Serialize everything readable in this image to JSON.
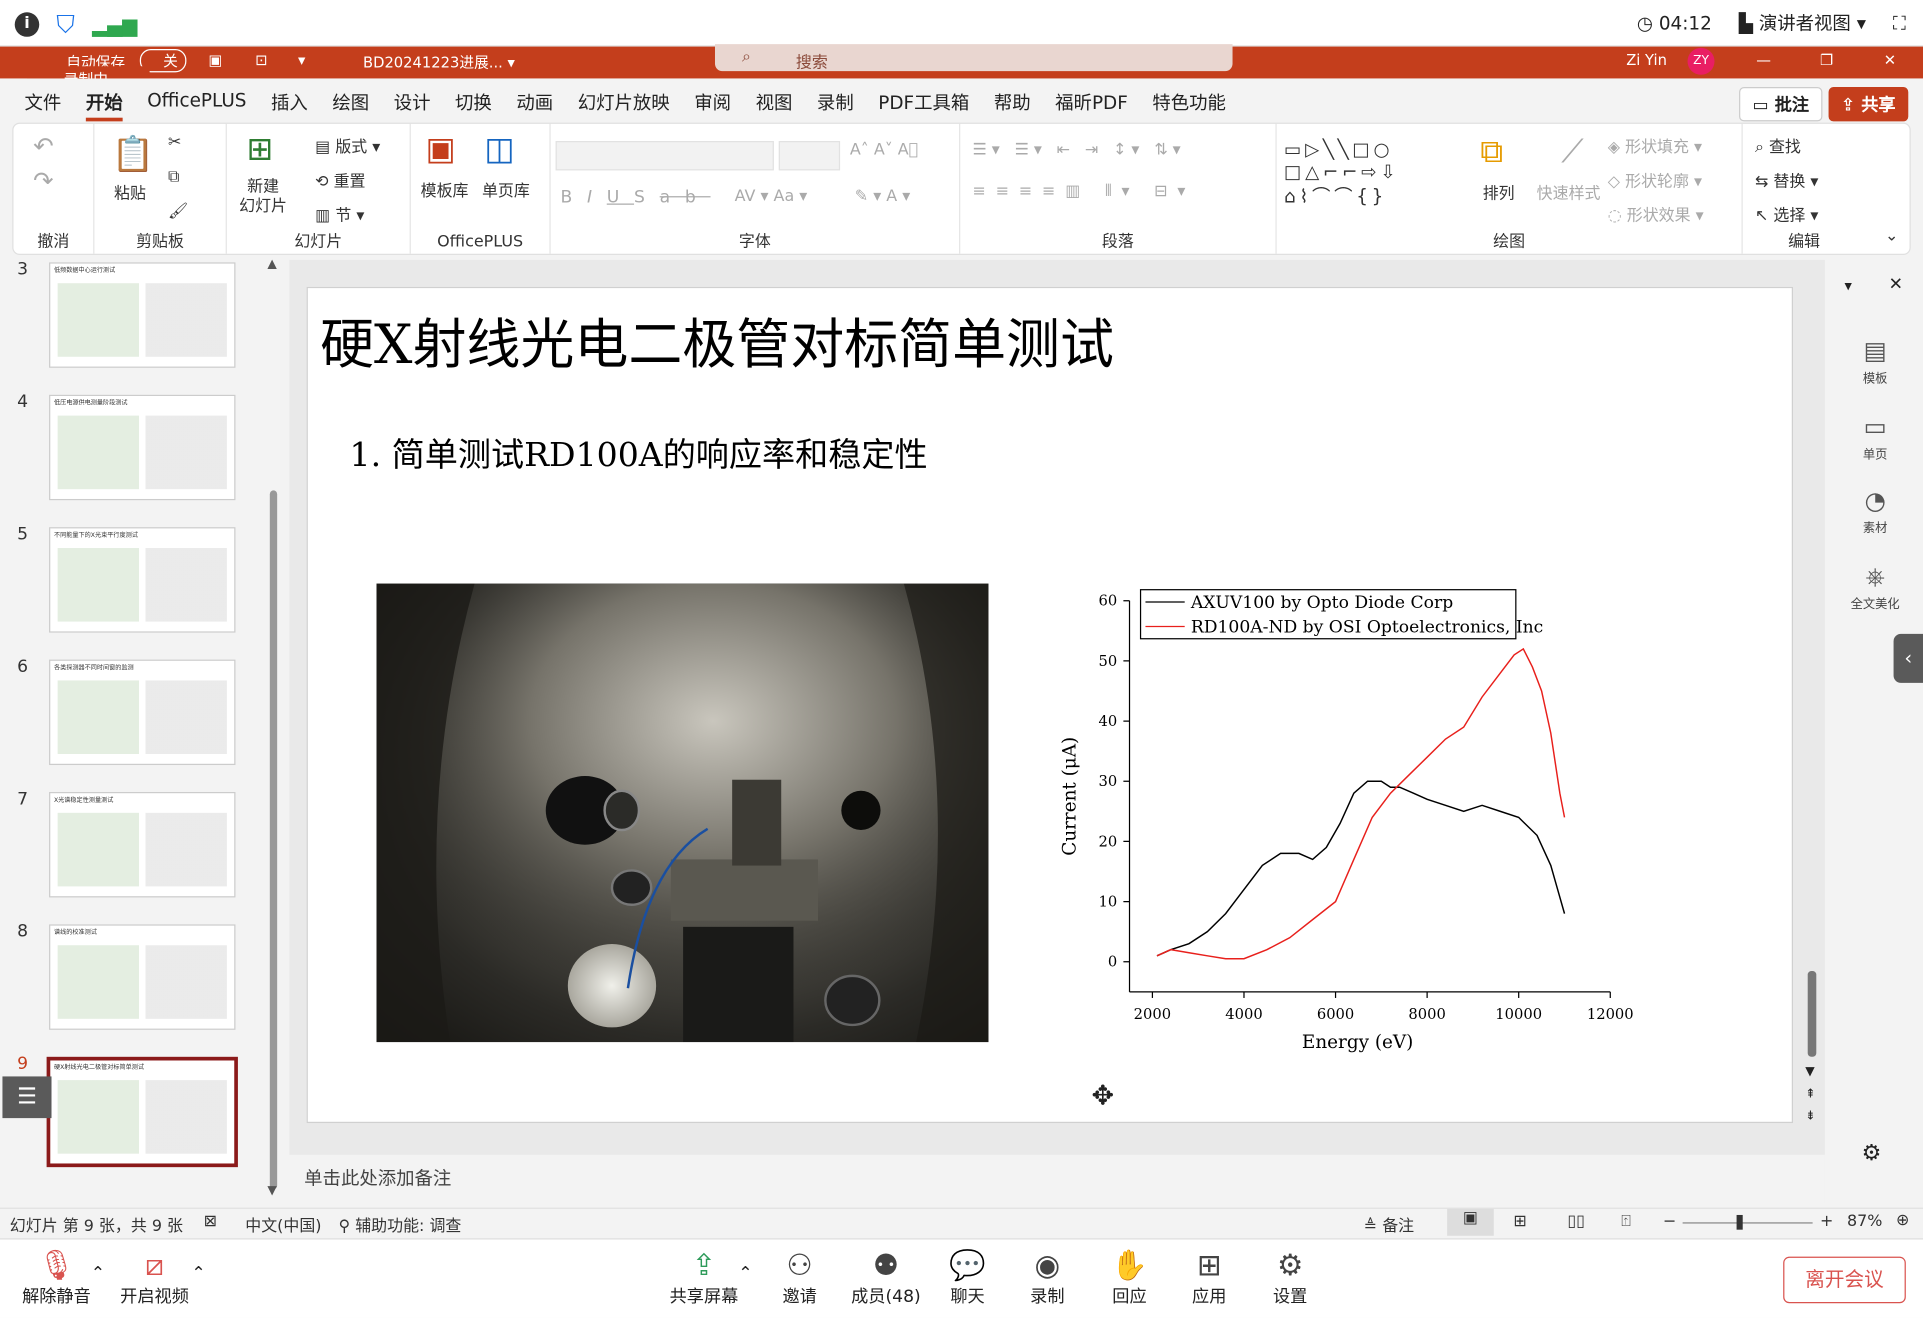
{
  "status": {
    "time": "04:12",
    "presenter_view": "演讲者视图"
  },
  "titlebar": {
    "autosave": "自动保存",
    "autosave_state": "关",
    "filename": "BD20241223进展...",
    "search_placeholder": "搜索",
    "user": "Zi Yin",
    "user_initials": "ZY",
    "recording": "录制中"
  },
  "menu": {
    "tabs": [
      "文件",
      "开始",
      "OfficePLUS",
      "插入",
      "绘图",
      "设计",
      "切换",
      "动画",
      "幻灯片放映",
      "审阅",
      "视图",
      "录制",
      "PDF工具箱",
      "帮助",
      "福昕PDF",
      "特色功能"
    ],
    "active": "开始",
    "comment": "批注",
    "share": "共享"
  },
  "ribbon": {
    "undo_group": "撤消",
    "clipboard": {
      "paste": "粘贴",
      "group": "剪贴板"
    },
    "slides": {
      "new_slide": "新建\n幻灯片",
      "layout": "版式",
      "reset": "重置",
      "section": "节",
      "group": "幻灯片"
    },
    "officeplus": {
      "template": "模板库",
      "single": "单页库",
      "group": "OfficePLUS"
    },
    "font": {
      "group": "字体"
    },
    "paragraph": {
      "group": "段落"
    },
    "drawing": {
      "arrange": "排列",
      "quick_style": "快速样式",
      "fill": "形状填充",
      "outline": "形状轮廓",
      "effect": "形状效果",
      "group": "绘图"
    },
    "editing": {
      "find": "查找",
      "replace": "替换",
      "select": "选择",
      "group": "编辑"
    }
  },
  "thumbnails": [
    {
      "num": "3",
      "title": "低频数据中心运行测试"
    },
    {
      "num": "4",
      "title": "低压电源供电测量阶段测试"
    },
    {
      "num": "5",
      "title": "不同能量下的X光束平行度测试"
    },
    {
      "num": "6",
      "title": "各类探测器不同时间窗的监测"
    },
    {
      "num": "7",
      "title": "X光谱稳定性测量测试"
    },
    {
      "num": "8",
      "title": "谱线的校准测试"
    },
    {
      "num": "9",
      "title": "硬X射线光电二极管对标简单测试"
    }
  ],
  "slide": {
    "title": "硬X射线光电二极管对标简单测试",
    "bullet": "1.  简单测试RD100A的响应率和稳定性"
  },
  "chart_data": {
    "type": "line",
    "xlabel": "Energy (eV)",
    "ylabel": "Current (μA)",
    "xlim": [
      1500,
      12000
    ],
    "ylim": [
      -5,
      60
    ],
    "xticks": [
      "2000",
      "4000",
      "6000",
      "8000",
      "10000",
      "12000"
    ],
    "yticks": [
      "0",
      "10",
      "20",
      "30",
      "40",
      "50",
      "60"
    ],
    "legend_position": "top",
    "series": [
      {
        "name": "AXUV100 by Opto Diode Corp",
        "color": "#000000",
        "x": [
          2100,
          2400,
          2800,
          3200,
          3600,
          4000,
          4400,
          4800,
          5200,
          5500,
          5800,
          6100,
          6400,
          6700,
          7000,
          7200,
          7400,
          7700,
          8000,
          8400,
          8800,
          9200,
          9600,
          10000,
          10400,
          10700,
          11000
        ],
        "y": [
          1,
          2,
          3,
          5,
          8,
          12,
          16,
          18,
          18,
          17,
          19,
          23,
          28,
          30,
          30,
          29,
          29,
          28,
          27,
          26,
          25,
          26,
          25,
          24,
          21,
          16,
          8
        ]
      },
      {
        "name": "RD100A-ND by OSI Optoelectronics, Inc",
        "color": "#e8201c",
        "x": [
          2100,
          2400,
          2800,
          3200,
          3600,
          4000,
          4500,
          5000,
          5500,
          6000,
          6400,
          6800,
          7200,
          7600,
          8000,
          8400,
          8800,
          9200,
          9600,
          9900,
          10100,
          10300,
          10500,
          10700,
          10900,
          11000
        ],
        "y": [
          1,
          2,
          1.5,
          1,
          0.5,
          0.5,
          2,
          4,
          7,
          10,
          17,
          24,
          28,
          31,
          34,
          37,
          39,
          44,
          48,
          51,
          52,
          49,
          45,
          38,
          28,
          24
        ]
      }
    ]
  },
  "notes": "单击此处添加备注",
  "right_side": {
    "template": "模板",
    "single": "单页",
    "material": "素材",
    "beautify": "全文美化"
  },
  "pptstatus": {
    "slide_info": "幻灯片 第 9 张，共 9 张",
    "lang": "中文(中国)",
    "access": "辅助功能: 调查",
    "notes": "备注",
    "zoom": "87%"
  },
  "meeting": {
    "mute": "解除静音",
    "video": "开启视频",
    "share": "共享屏幕",
    "invite": "邀请",
    "members": "成员(48)",
    "chat": "聊天",
    "record": "录制",
    "react": "回应",
    "apps": "应用",
    "settings": "设置",
    "leave": "离开会议"
  }
}
